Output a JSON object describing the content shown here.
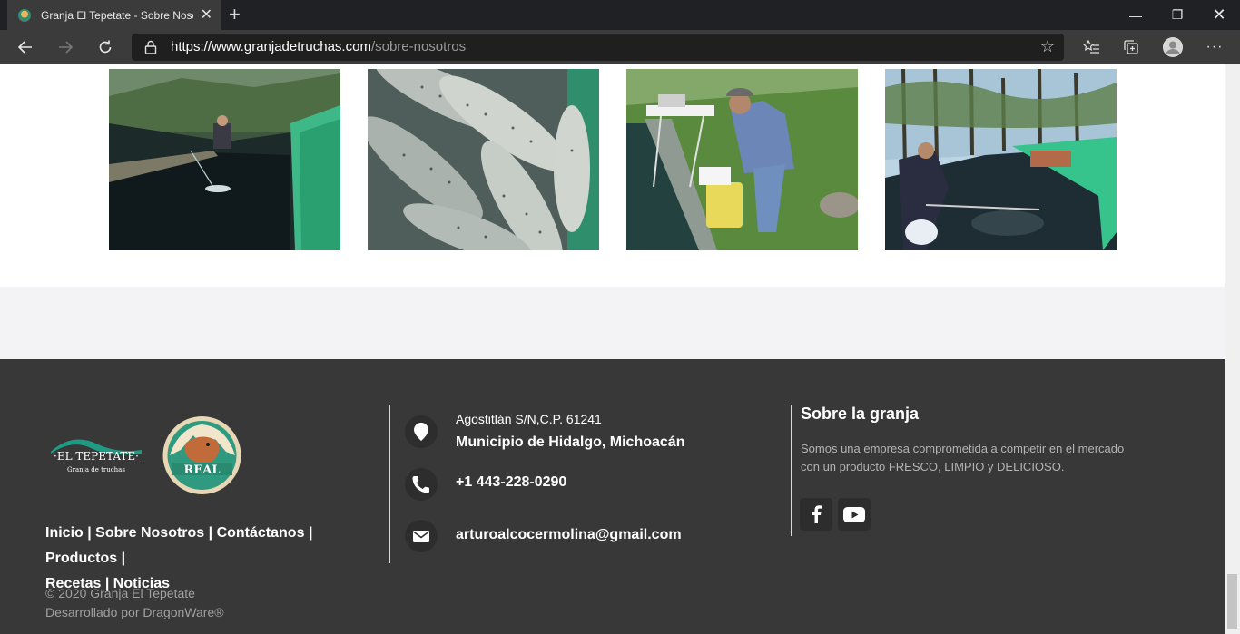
{
  "browser": {
    "tab_title": "Granja El Tepetate - Sobre Nosotros",
    "tab_close": "✕",
    "new_tab": "+",
    "url_host": "https://www.granjadetruchas.com",
    "url_path": "/sobre-nosotros",
    "window_controls": {
      "minimize": "—",
      "maximize": "❐",
      "close": "✕"
    },
    "icons": [
      "back-icon",
      "forward-icon",
      "reload-icon",
      "lock-icon",
      "star-icon",
      "favorites-icon",
      "collections-icon",
      "profile-icon",
      "more-icon"
    ]
  },
  "gallery": {
    "photos": [
      {
        "name": "trout-pond-person-kneeling"
      },
      {
        "name": "pile-of-rainbow-trout"
      },
      {
        "name": "man-with-bucket-and-scale"
      },
      {
        "name": "man-netting-fish-in-pond"
      }
    ]
  },
  "footer": {
    "logo_text_1": "·EL TEPETATE·",
    "logo_text_2": "Granja de truchas",
    "logo_real": "REAL",
    "links": [
      "Inicio",
      "Sobre Nosotros",
      "Contáctanos",
      "Productos",
      "Recetas",
      "Noticias"
    ],
    "separator": "|",
    "copyright": "© 2020 Granja El Tepetate",
    "developer": "Desarrollado por DragonWare®",
    "address_line1": "Agostitlán S/N,C.P. 61241",
    "address_line2": "Municipio de Hidalgo, Michoacán",
    "phone": "+1 443-228-0290",
    "email": "arturoalcocermolina@gmail.com",
    "about_title": "Sobre la granja",
    "about_text": "Somos una empresa comprometida a competir en el mercado con un producto FRESCO, LIMPIO y DELICIOSO.",
    "social": [
      "facebook-icon",
      "youtube-icon"
    ]
  },
  "colors": {
    "footer_bg": "#383838",
    "band_bg": "#f3f3f5",
    "chrome_bg": "#3b3b3b"
  }
}
